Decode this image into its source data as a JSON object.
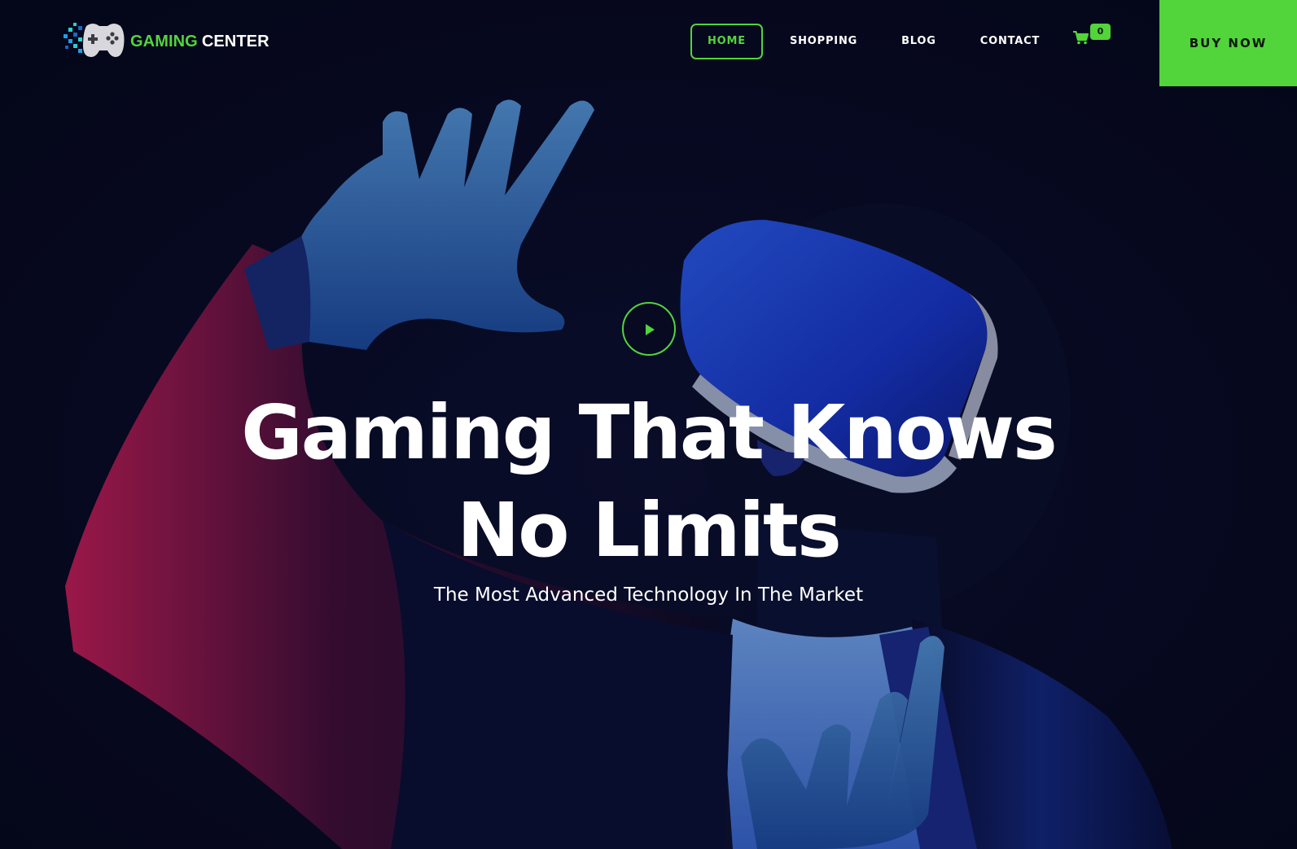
{
  "brand": {
    "name_accent": "GAMING",
    "name_rest": "CENTER",
    "logo_icon": "gamepad-pixel-logo",
    "accent_color": "#52d43b"
  },
  "nav": {
    "items": [
      {
        "label": "HOME",
        "active": true
      },
      {
        "label": "SHOPPING",
        "active": false
      },
      {
        "label": "BLOG",
        "active": false
      },
      {
        "label": "CONTACT",
        "active": false
      }
    ]
  },
  "cart": {
    "icon": "shopping-cart-icon",
    "count": "0"
  },
  "cta": {
    "buy_now_label": "BUY NOW"
  },
  "hero": {
    "play_icon": "play-icon",
    "title_line_1": "Gaming That Knows",
    "title_line_2": "No Limits",
    "subtitle": "The Most Advanced Technology In The Market",
    "background_image": "person wearing VR headset with raised hand, neon blue and pink lighting"
  }
}
